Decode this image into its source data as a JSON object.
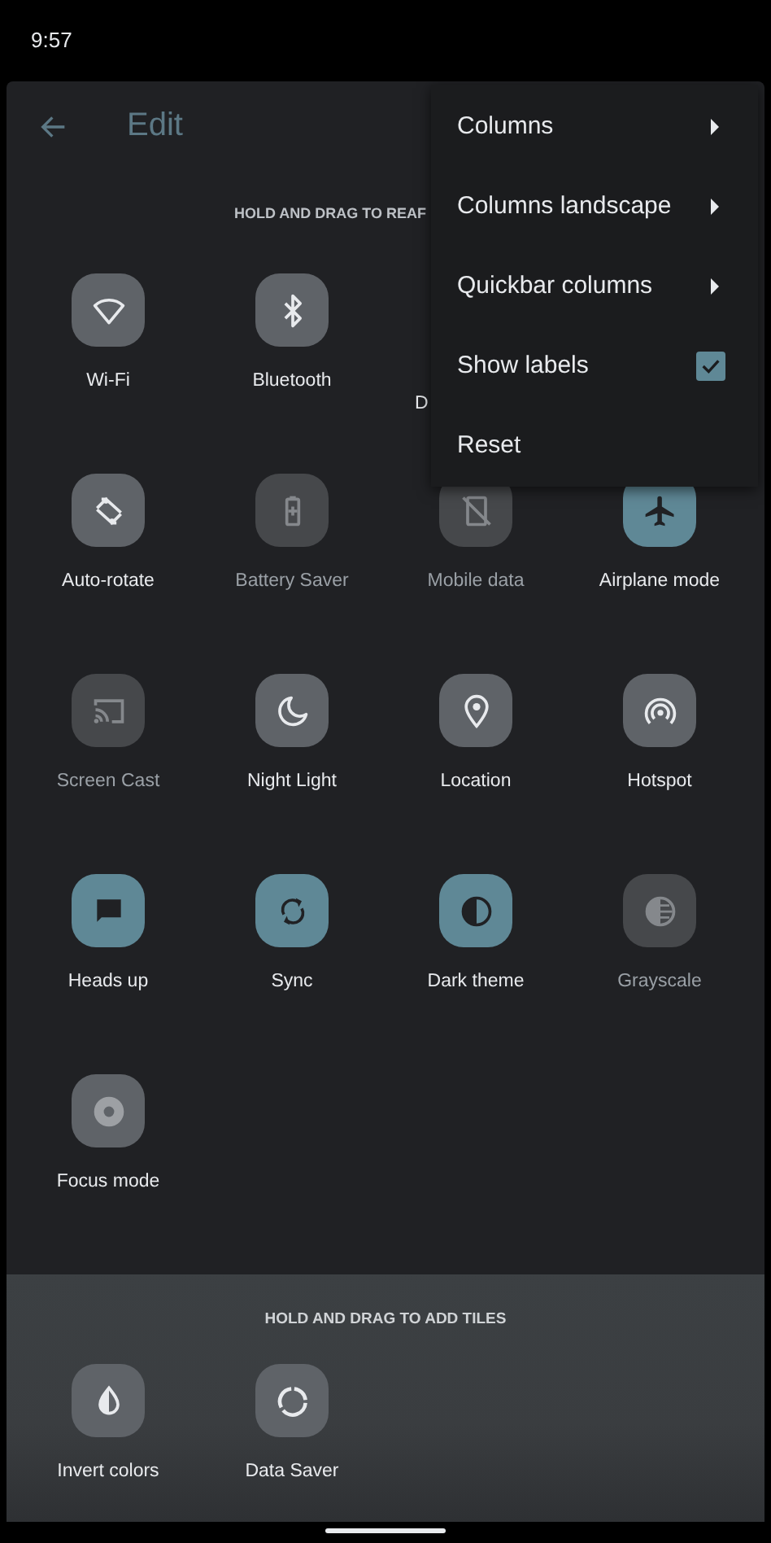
{
  "status_bar": {
    "time": "9:57"
  },
  "header": {
    "title": "Edit"
  },
  "current_tiles": {
    "title": "HOLD AND DRAG TO REAF",
    "tiles": [
      {
        "label": "Wi-Fi",
        "on": false,
        "disabled": false
      },
      {
        "label": "Bluetooth",
        "on": false,
        "disabled": false
      },
      {
        "label": "D",
        "disabled": false,
        "kind": "partial"
      },
      {
        "label": "Auto-rotate",
        "on": false,
        "disabled": false
      },
      {
        "label": "Battery Saver",
        "on": false,
        "disabled": true
      },
      {
        "label": "Mobile data",
        "on": false,
        "disabled": true
      },
      {
        "label": "Airplane mode",
        "on": true,
        "disabled": false
      },
      {
        "label": "Screen Cast",
        "on": false,
        "disabled": true
      },
      {
        "label": "Night Light",
        "on": false,
        "disabled": false
      },
      {
        "label": "Location",
        "on": false,
        "disabled": false
      },
      {
        "label": "Hotspot",
        "on": false,
        "disabled": false
      },
      {
        "label": "Heads up",
        "on": true,
        "disabled": false
      },
      {
        "label": "Sync",
        "on": true,
        "disabled": false
      },
      {
        "label": "Dark theme",
        "on": true,
        "disabled": false
      },
      {
        "label": "Grayscale",
        "on": false,
        "disabled": true
      },
      {
        "label": "Focus mode",
        "on": false,
        "disabled": false
      }
    ]
  },
  "available_tiles": {
    "title": "HOLD AND DRAG TO ADD TILES",
    "tiles": [
      {
        "label": "Invert colors",
        "on": false,
        "disabled": false
      },
      {
        "label": "Data Saver",
        "on": false,
        "disabled": false
      }
    ]
  },
  "menu": {
    "items": [
      {
        "label": "Columns",
        "kind": "submenu"
      },
      {
        "label": "Columns landscape",
        "kind": "submenu"
      },
      {
        "label": "Quickbar columns",
        "kind": "submenu"
      },
      {
        "label": "Show labels",
        "kind": "checkbox",
        "checked": true
      },
      {
        "label": "Reset",
        "kind": "plain"
      }
    ]
  }
}
